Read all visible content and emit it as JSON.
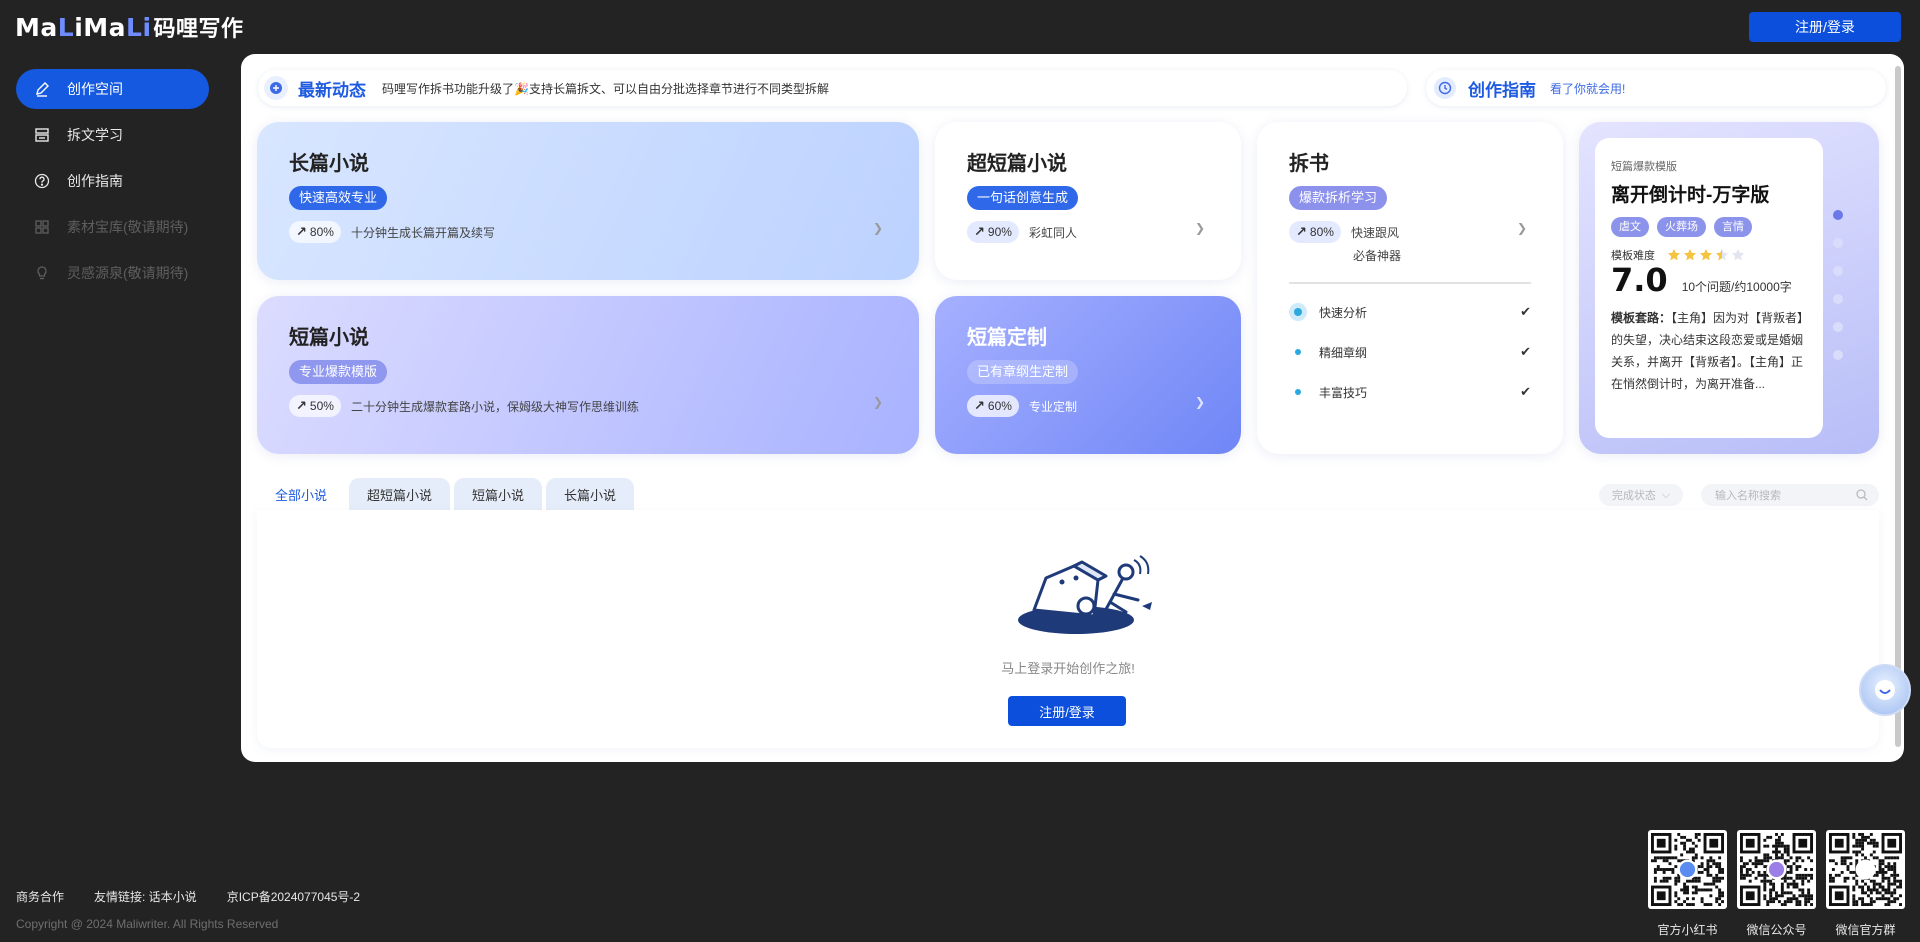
{
  "header": {
    "logo_left": "Ma",
    "logo_a": "L",
    "logo_mid": "iMa",
    "logo_end": "Li",
    "logo_cn": "码哩写作",
    "login_label": "注册/登录"
  },
  "sidebar": {
    "items": [
      {
        "label": "创作空间",
        "icon": "pen-icon"
      },
      {
        "label": "拆文学习",
        "icon": "layers-icon"
      },
      {
        "label": "创作指南",
        "icon": "help-circle-icon"
      },
      {
        "label": "素材宝库(敬请期待)",
        "icon": "grid-icon"
      },
      {
        "label": "灵感源泉(敬请期待)",
        "icon": "bulb-icon"
      }
    ]
  },
  "news": {
    "title": "最新动态",
    "text": "码哩写作拆书功能升级了🎉支持长篇拆文、可以自由分批选择章节进行不同类型拆解"
  },
  "guide": {
    "title": "创作指南",
    "link": "看了你就会用!"
  },
  "cards": {
    "long": {
      "title": "长篇小说",
      "tag": "快速高效专业",
      "pct": "80%",
      "desc": "十分钟生成长篇开篇及续写"
    },
    "short": {
      "title": "短篇小说",
      "tag": "专业爆款模版",
      "pct": "50%",
      "desc": "二十分钟生成爆款套路小说，保姆级大神写作思维训练"
    },
    "ultra": {
      "title": "超短篇小说",
      "tag": "一句话创意生成",
      "pct": "90%",
      "desc": "彩虹同人"
    },
    "custom": {
      "title": "短篇定制",
      "tag": "已有章纲生定制",
      "pct": "60%",
      "desc": "专业定制"
    },
    "chai": {
      "title": "拆书",
      "tag": "爆款拆析学习",
      "pct": "80%",
      "desc1": "快速跟风",
      "desc2": "必备神器",
      "features": [
        "快速分析",
        "精细章纲",
        "丰富技巧"
      ],
      "check": "✔"
    },
    "template": {
      "category": "短篇爆款模版",
      "title": "离开倒计时-万字版",
      "tags": [
        "虐文",
        "火葬场",
        "言情"
      ],
      "difficulty_label": "模板难度",
      "rating": 3.5,
      "score": "7.0",
      "score_note": "10个问题/约10000字",
      "desc_label": "模板套路：",
      "desc": "【主角】因为对【背叛者】的失望，决心结束这段恋爱或是婚姻关系，并离开【背叛者】。【主角】正在悄然倒计时，为离开准备..."
    }
  },
  "tabs": [
    "全部小说",
    "超短篇小说",
    "短篇小说",
    "长篇小说"
  ],
  "filters": {
    "status_label": "完成状态",
    "search_placeholder": "输入名称搜索"
  },
  "empty": {
    "text": "马上登录开始创作之旅!",
    "button": "注册/登录"
  },
  "footer": {
    "links": [
      "商务合作",
      "友情链接: 话本小说",
      "京ICP备2024077045号-2"
    ],
    "copyright": "Copyright @ 2024 Maliwriter. All Rights Reserved",
    "qrcodes": [
      "官方小红书",
      "微信公众号",
      "微信官方群"
    ]
  },
  "colors": {
    "primary": "#0b4fdc",
    "accent": "#1e5be0",
    "background": "#232323"
  }
}
